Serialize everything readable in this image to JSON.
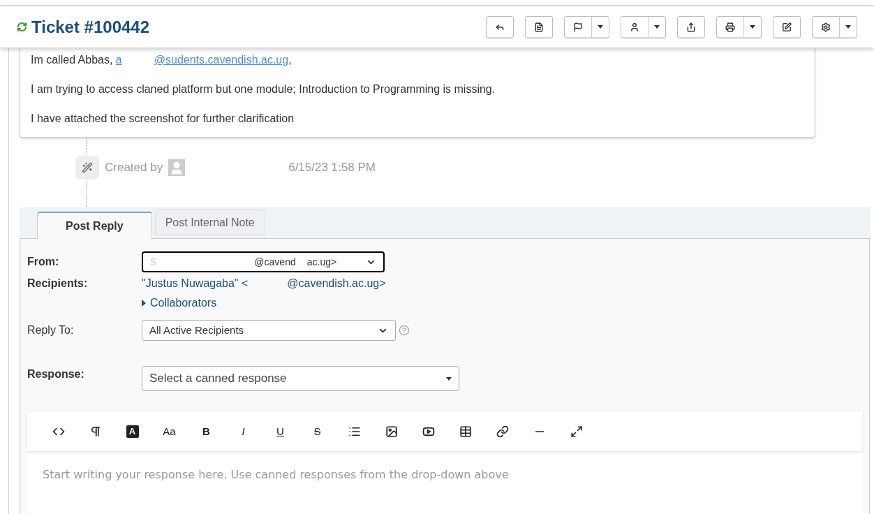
{
  "header": {
    "title": "Ticket #100442",
    "actions": [
      {
        "dropdown": false
      },
      {
        "dropdown": false
      },
      {
        "dropdown": true
      },
      {
        "dropdown": true
      },
      {
        "dropdown": false
      },
      {
        "dropdown": true
      },
      {
        "dropdown": false
      },
      {
        "dropdown": true
      }
    ]
  },
  "message": {
    "intro": "Im called Abbas,",
    "link_start": "a",
    "link_end": "@sudents.cavendish.ac.ug",
    "link_after": ",",
    "paragraphs": [
      "I am trying to access claned platform but one module; Introduction to Programming is missing.",
      "I have attached the screenshot for further clarification"
    ]
  },
  "event": {
    "label": "Created by",
    "time": "6/15/23 1:58 PM"
  },
  "tabs": [
    {
      "label": "Post Reply",
      "selected": true
    },
    {
      "label": "Post Internal Note",
      "selected": false
    }
  ],
  "form": {
    "from_label": "From:",
    "from_start": "S",
    "from_end": "@cavend",
    "from_tail": "ac.ug>",
    "recipients_label": "Recipients:",
    "recipient_start": "\"Justus Nuwagaba\" <",
    "recipient_end": "@cavendish.ac.ug>",
    "collaborators": "Collaborators",
    "collaborators_expanded": false,
    "reply_to_label": "Reply To:",
    "reply_to_value": "All Active Recipients",
    "response_label": "Response:",
    "response_placeholder": "Select a canned response"
  },
  "editor": {
    "tools": [
      {
        "kind": "icon"
      },
      {
        "kind": "icon"
      },
      {
        "kind": "boxed",
        "label": "A"
      },
      {
        "kind": "text",
        "label": "Aa"
      },
      {
        "kind": "text",
        "label": "B"
      },
      {
        "kind": "text",
        "label": "I"
      },
      {
        "kind": "text",
        "label": "U"
      },
      {
        "kind": "text",
        "label": "S"
      },
      {
        "kind": "icon"
      },
      {
        "kind": "icon"
      },
      {
        "kind": "icon"
      },
      {
        "kind": "icon"
      },
      {
        "kind": "icon"
      },
      {
        "kind": "icon"
      },
      {
        "kind": "icon"
      }
    ],
    "placeholder": "Start writing your response here. Use canned responses from the drop-down above"
  }
}
